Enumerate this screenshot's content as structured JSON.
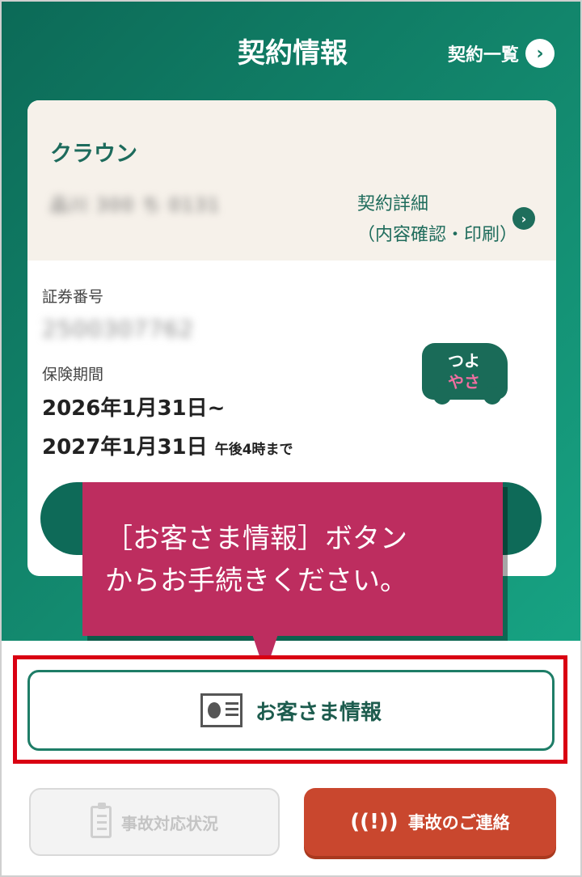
{
  "header": {
    "title": "契約情報",
    "list_link": "契約一覧"
  },
  "card": {
    "car_name": "クラウン",
    "plate": "品川 300 ち 0131",
    "detail_link_line1": "契約詳細",
    "detail_link_line2": "（内容確認・印刷）",
    "policy_label": "証券番号",
    "policy_number": "2500307762",
    "period_label": "保険期間",
    "period_start": "2026年1月31日~",
    "period_end": "2027年1月31日",
    "period_end_suffix": "午後4時まで",
    "sticker_line1": "つよ",
    "sticker_line2": "やさ"
  },
  "callout": {
    "line1": "［お客さま情報］ボタン",
    "line2": "からお手続きください。"
  },
  "buttons": {
    "customer_info": "お客さま情報",
    "accident_status": "事故対応状況",
    "accident_contact": "事故のご連絡"
  },
  "colors": {
    "brand_green": "#138a6f",
    "callout": "#bd2d5f",
    "highlight": "#d90012",
    "contact": "#c9472e"
  },
  "icons": {
    "list_chevron": "chevron-right-icon",
    "customer": "id-card-icon",
    "status": "clipboard-icon",
    "contact": "alert-signal-icon"
  }
}
